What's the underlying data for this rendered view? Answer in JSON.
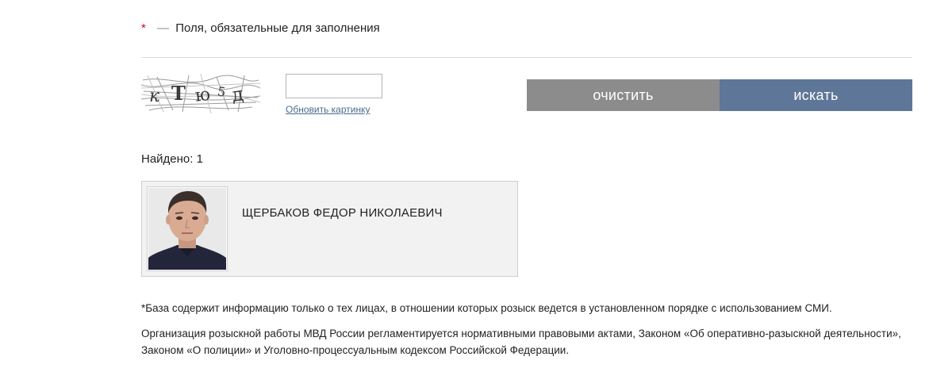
{
  "form": {
    "required_star": "*",
    "required_dash": "—",
    "required_text": "Поля, обязательные для заполнения",
    "captcha": {
      "image_text": [
        "к",
        "Т",
        "ю",
        "5",
        "д"
      ],
      "input_value": "",
      "refresh_label": "Обновить картинку"
    },
    "clear_label": "очистить",
    "search_label": "искать"
  },
  "results": {
    "found_label": "Найдено: 1",
    "items": [
      {
        "name": "ЩЕРБАКОВ ФЕДОР НИКОЛАЕВИЧ"
      }
    ]
  },
  "footer": {
    "footnote": "*База содержит информацию только о тех лицах, в отношении которых розыск ведется в установленном порядке с использованием СМИ.",
    "legal": "Организация розыскной работы МВД России регламентируется нормативными правовыми актами, Законом «Об оперативно-разыскной деятельности», Законом «О полиции» и Уголовно-процессуальным кодексом Российской Федерации."
  },
  "colors": {
    "required_star": "#d0021b",
    "clear_button": "#8c8c8c",
    "search_button": "#5e7697",
    "link": "#4a6c8f",
    "card_background": "#f2f2f2"
  }
}
